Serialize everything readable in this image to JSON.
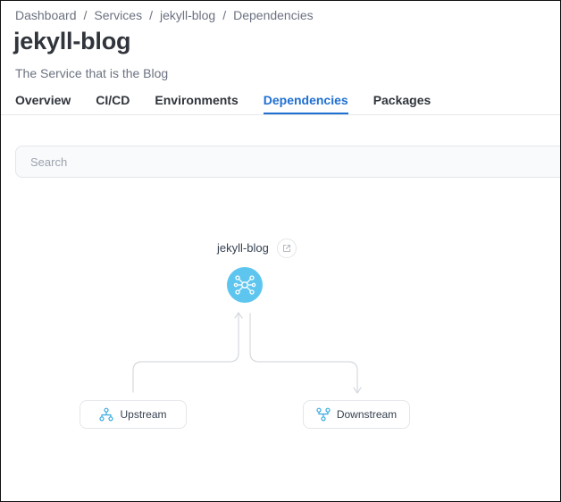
{
  "breadcrumb": {
    "items": [
      "Dashboard",
      "Services",
      "jekyll-blog",
      "Dependencies"
    ],
    "separator": "/"
  },
  "header": {
    "title": "jekyll-blog",
    "subtitle": "The Service that is the Blog"
  },
  "tabs": [
    {
      "label": "Overview"
    },
    {
      "label": "CI/CD"
    },
    {
      "label": "Environments"
    },
    {
      "label": "Dependencies",
      "active": true
    },
    {
      "label": "Packages"
    }
  ],
  "search": {
    "placeholder": "Search",
    "value": ""
  },
  "graph": {
    "node": {
      "label": "jekyll-blog",
      "icon": "service-hub-icon",
      "link_icon": "external-link-icon"
    },
    "upstream": {
      "label": "Upstream",
      "icon": "upstream-tree-icon"
    },
    "downstream": {
      "label": "Downstream",
      "icon": "downstream-tree-icon"
    }
  },
  "colors": {
    "accent": "#1f6fd1",
    "node": "#5ec6ee",
    "text": "#30343b",
    "muted": "#6b7280",
    "border": "#e4e6ea",
    "connector": "#d6d9de"
  }
}
